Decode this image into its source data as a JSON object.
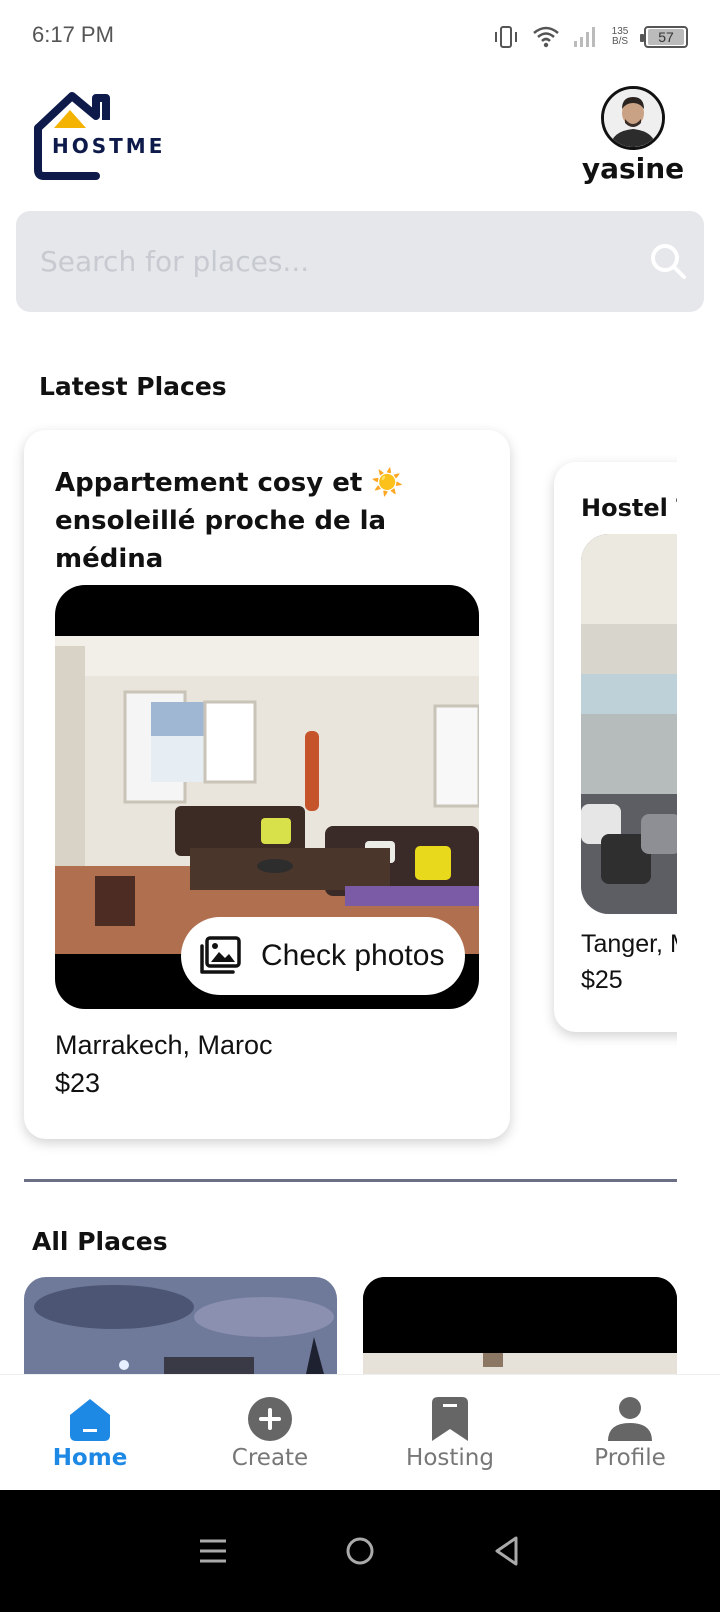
{
  "status_bar": {
    "time": "6:17 PM",
    "net_speed_value": "135",
    "net_speed_unit": "B/S",
    "battery": "57"
  },
  "header": {
    "logo_text": "HOSTME",
    "user_name": "yasine"
  },
  "search": {
    "placeholder": "Search for places..."
  },
  "latest_places": {
    "title": "Latest Places",
    "items": [
      {
        "title": "Appartement cosy et ☀️ ensoleillé proche de la médina",
        "location": "Marrakech, Maroc",
        "price": "$23",
        "check_photos_label": "Check photos"
      },
      {
        "title": "Hostel T",
        "location": "Tanger, M",
        "price": "$25"
      }
    ]
  },
  "all_places": {
    "title": "All Places"
  },
  "bottom_nav": {
    "items": [
      {
        "label": "Home",
        "icon": "home-icon",
        "active": true
      },
      {
        "label": "Create",
        "icon": "plus-circle-icon",
        "active": false
      },
      {
        "label": "Hosting",
        "icon": "bookmark-icon",
        "active": false
      },
      {
        "label": "Profile",
        "icon": "person-icon",
        "active": false
      }
    ]
  },
  "colors": {
    "accent": "#1e88e5",
    "brand_navy": "#0e1a4a",
    "brand_yellow": "#f5b301",
    "search_bg": "#e5e7eb",
    "inactive": "#777777"
  }
}
